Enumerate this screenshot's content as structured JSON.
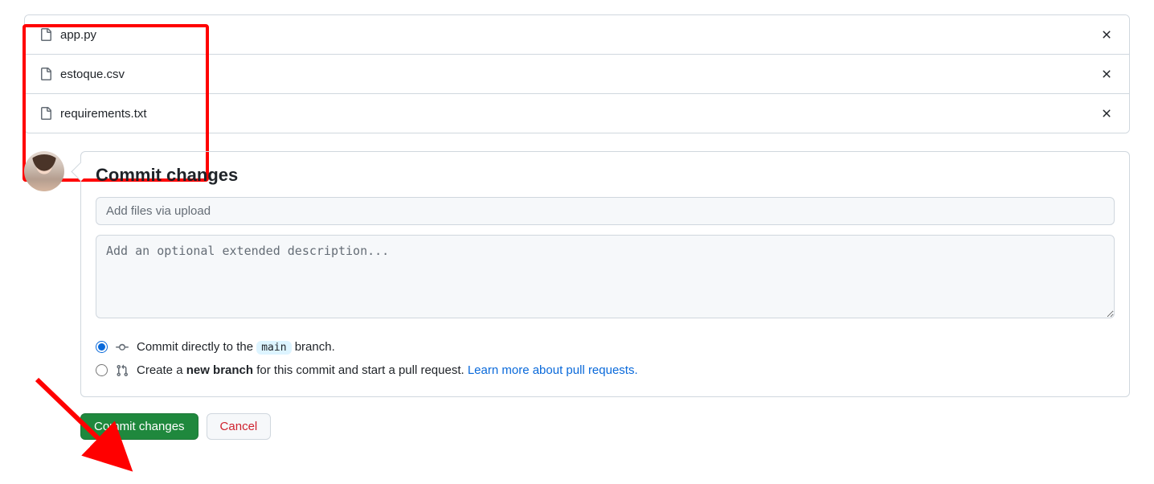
{
  "files": [
    {
      "name": "app.py"
    },
    {
      "name": "estoque.csv"
    },
    {
      "name": "requirements.txt"
    }
  ],
  "commit": {
    "heading": "Commit changes",
    "summary_placeholder": "Add files via upload",
    "description_placeholder": "Add an optional extended description...",
    "radio_direct_prefix": "Commit directly to the ",
    "radio_direct_branch": "main",
    "radio_direct_suffix": " branch.",
    "radio_newbranch_prefix": "Create a ",
    "radio_newbranch_bold": "new branch",
    "radio_newbranch_suffix": " for this commit and start a pull request. ",
    "learn_more": "Learn more about pull requests.",
    "commit_button": "Commit changes",
    "cancel_button": "Cancel"
  }
}
